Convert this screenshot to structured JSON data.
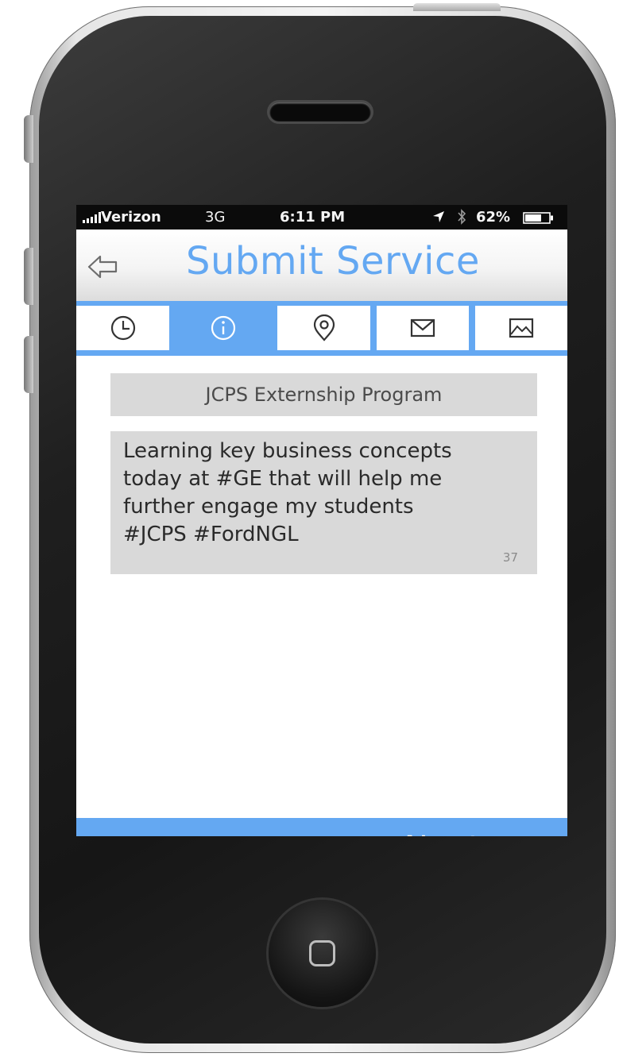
{
  "status_bar": {
    "carrier": "Verizon",
    "network": "3G",
    "time": "6:11 PM",
    "battery": "62%",
    "icons": [
      "signal-bars-icon",
      "location-arrow-icon",
      "bluetooth-icon",
      "battery-icon"
    ]
  },
  "header": {
    "title": "Submit Service",
    "back_icon": "back-arrow-icon"
  },
  "tabs": [
    {
      "icon": "clock-icon",
      "active": false
    },
    {
      "icon": "info-icon",
      "active": true
    },
    {
      "icon": "location-pin-icon",
      "active": false
    },
    {
      "icon": "mail-icon",
      "active": false
    },
    {
      "icon": "image-icon",
      "active": false
    }
  ],
  "form": {
    "program": "JCPS Externship Program",
    "message": "Learning key business concepts\ntoday at #GE that will help me\nfurther engage my students\n#JCPS #FordNGL",
    "char_count": "37"
  },
  "footer": {
    "next_label": "Next",
    "next_icon": "chevron-circle-right-icon"
  },
  "colors": {
    "accent": "#64a8f2",
    "field_background": "#d9d9d9",
    "status_bar": "#0b0b0b"
  }
}
